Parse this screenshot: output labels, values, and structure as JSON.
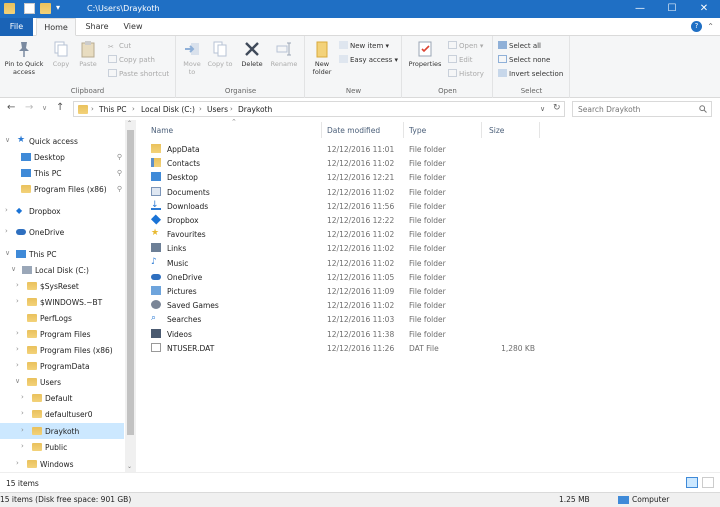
{
  "window": {
    "title": "C:\\Users\\Draykoth"
  },
  "tabs": [
    "File",
    "Home",
    "Share",
    "View"
  ],
  "ribbon": {
    "clipboard": {
      "label": "Clipboard",
      "pin": "Pin to Quick access",
      "copy": "Copy",
      "paste": "Paste",
      "cut": "Cut",
      "copy_path": "Copy path",
      "paste_shortcut": "Paste shortcut"
    },
    "organise": {
      "label": "Organise",
      "move_to": "Move to",
      "copy_to": "Copy to",
      "delete": "Delete",
      "rename": "Rename"
    },
    "new": {
      "label": "New",
      "new_folder": "New folder",
      "new_item": "New item",
      "easy_access": "Easy access"
    },
    "open": {
      "label": "Open",
      "properties": "Properties",
      "open": "Open",
      "edit": "Edit",
      "history": "History"
    },
    "select": {
      "label": "Select",
      "select_all": "Select all",
      "select_none": "Select none",
      "invert": "Invert selection"
    }
  },
  "address": {
    "crumbs": [
      "This PC",
      "Local Disk (C:)",
      "Users",
      "Draykoth"
    ]
  },
  "search": {
    "placeholder": "Search Draykoth"
  },
  "nav": {
    "quick_access": "Quick access",
    "desktop": "Desktop",
    "this_pc_pinned": "This PC",
    "program_files_x86_pinned": "Program Files (x86)",
    "dropbox": "Dropbox",
    "onedrive": "OneDrive",
    "this_pc": "This PC",
    "local_disk": "Local Disk (C:)",
    "c_items": [
      "$SysReset",
      "$WINDOWS.~BT",
      "PerfLogs",
      "Program Files",
      "Program Files (x86)",
      "ProgramData",
      "Users"
    ],
    "user_items": [
      "Default",
      "defaultuser0",
      "Draykoth",
      "Public"
    ],
    "windows": "Windows"
  },
  "columns": {
    "name": "Name",
    "date": "Date modified",
    "type": "Type",
    "size": "Size"
  },
  "files": [
    {
      "name": "AppData",
      "date": "12/12/2016 11:01",
      "type": "File folder",
      "size": "",
      "icon": "folder-icon"
    },
    {
      "name": "Contacts",
      "date": "12/12/2016 11:02",
      "type": "File folder",
      "size": "",
      "icon": "contacts-icon"
    },
    {
      "name": "Desktop",
      "date": "12/12/2016 12:21",
      "type": "File folder",
      "size": "",
      "icon": "desktop-icon"
    },
    {
      "name": "Documents",
      "date": "12/12/2016 11:02",
      "type": "File folder",
      "size": "",
      "icon": "documents-icon"
    },
    {
      "name": "Downloads",
      "date": "12/12/2016 11:56",
      "type": "File folder",
      "size": "",
      "icon": "downloads-icon"
    },
    {
      "name": "Dropbox",
      "date": "12/12/2016 12:22",
      "type": "File folder",
      "size": "",
      "icon": "dropbox-icon"
    },
    {
      "name": "Favourites",
      "date": "12/12/2016 11:02",
      "type": "File folder",
      "size": "",
      "icon": "star-icon"
    },
    {
      "name": "Links",
      "date": "12/12/2016 11:02",
      "type": "File folder",
      "size": "",
      "icon": "links-icon"
    },
    {
      "name": "Music",
      "date": "12/12/2016 11:02",
      "type": "File folder",
      "size": "",
      "icon": "music-icon"
    },
    {
      "name": "OneDrive",
      "date": "12/12/2016 11:05",
      "type": "File folder",
      "size": "",
      "icon": "onedrive-icon"
    },
    {
      "name": "Pictures",
      "date": "12/12/2016 11:09",
      "type": "File folder",
      "size": "",
      "icon": "pictures-icon"
    },
    {
      "name": "Saved Games",
      "date": "12/12/2016 11:02",
      "type": "File folder",
      "size": "",
      "icon": "games-icon"
    },
    {
      "name": "Searches",
      "date": "12/12/2016 11:03",
      "type": "File folder",
      "size": "",
      "icon": "searches-icon"
    },
    {
      "name": "Videos",
      "date": "12/12/2016 11:38",
      "type": "File folder",
      "size": "",
      "icon": "videos-icon"
    },
    {
      "name": "NTUSER.DAT",
      "date": "12/12/2016 11:26",
      "type": "DAT File",
      "size": "1,280 KB",
      "icon": "file-icon"
    }
  ],
  "status": {
    "items": "15 items",
    "bottom_left": "15 items (Disk free space: 901 GB)",
    "size": "1.25 MB",
    "location": "Computer"
  },
  "colors": {
    "accent": "#1f6fc4",
    "selection": "#cce8ff"
  }
}
